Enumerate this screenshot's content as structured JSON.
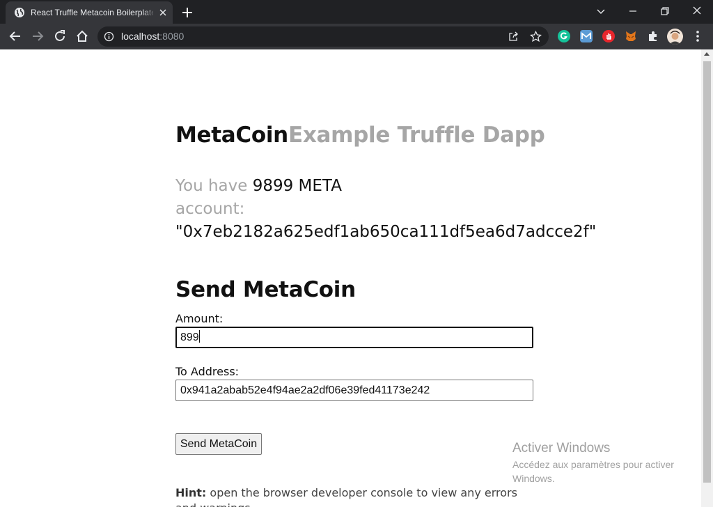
{
  "browser": {
    "tab_title": "React Truffle Metacoin Boilerplate",
    "url_host": "localhost",
    "url_port": ":8080"
  },
  "page": {
    "title_strong": "MetaCoin",
    "title_muted": "Example Truffle Dapp",
    "balance_prefix": "You have",
    "balance_value": "9899 META",
    "account_label": "account:",
    "account_value": "\"0x7eb2182a625edf1ab650ca111df5ea6d7adcce2f\"",
    "send_heading": "Send MetaCoin",
    "amount_label": "Amount:",
    "amount_value": "899",
    "address_label": "To Address:",
    "address_value": "0x941a2abab52e4f94ae2a2df06e39fed41173e242",
    "send_button": "Send MetaCoin",
    "hint_bold": "Hint:",
    "hint_text": " open the browser developer console to view any errors and warnings."
  },
  "watermark": {
    "title": "Activer Windows",
    "subtitle": "Accédez aux paramètres pour activer Windows."
  },
  "icons": {
    "extensions": [
      "grammarly-icon",
      "mail-extension-icon",
      "adblock-icon",
      "metamask-icon",
      "puzzle-icon"
    ]
  },
  "colors": {
    "chrome_dark": "#202124",
    "chrome_toolbar": "#35363a",
    "muted_text": "#a6a6a6",
    "grammarly": "#15c39a",
    "adblock": "#e8262c",
    "metamask": "#e2761b"
  }
}
